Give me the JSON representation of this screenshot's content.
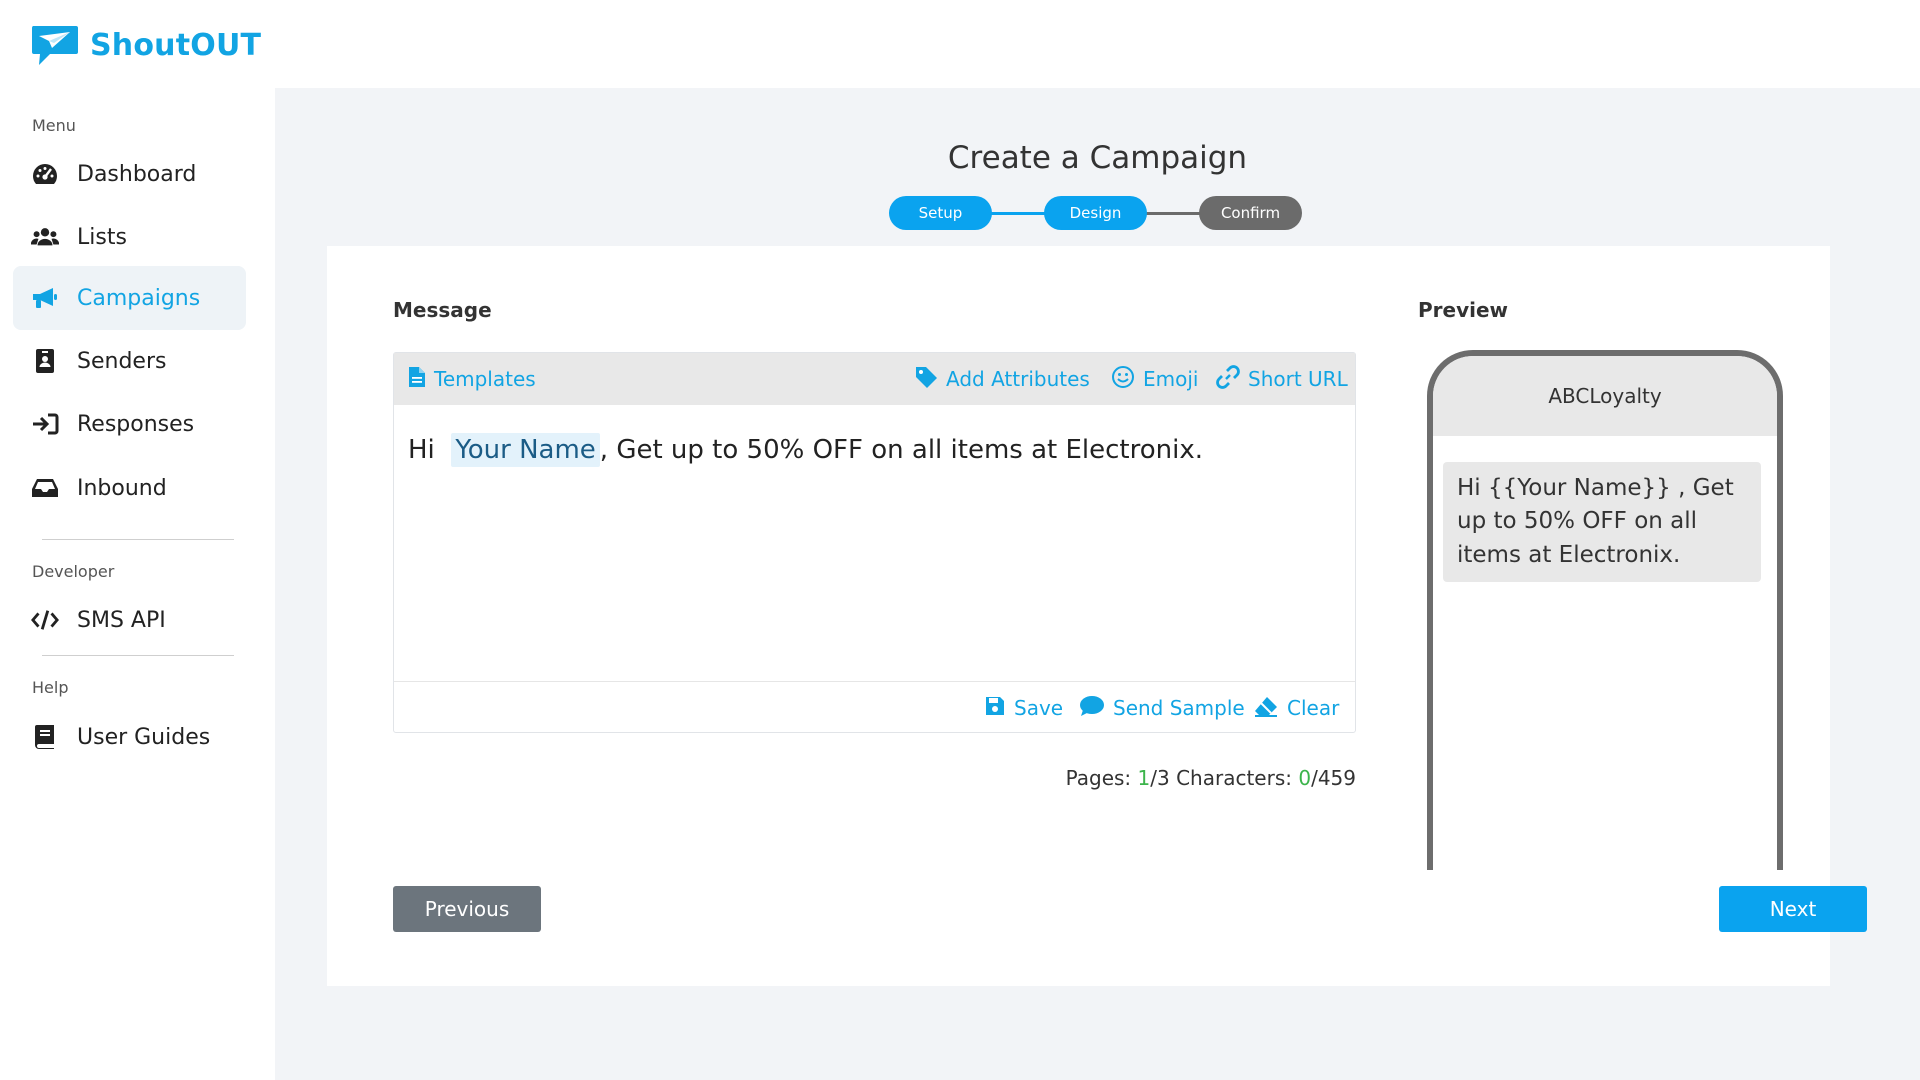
{
  "app": {
    "name": "ShoutOUT"
  },
  "colors": {
    "brand": "#12a4e3",
    "step_active": "#0aa3ef",
    "step_inactive": "#6b6b6b",
    "prev_button": "#6c757d",
    "count_green": "#3cb44b"
  },
  "sidebar": {
    "menu_label": "Menu",
    "items": [
      {
        "label": "Dashboard",
        "icon": "dashboard-icon"
      },
      {
        "label": "Lists",
        "icon": "users-icon"
      },
      {
        "label": "Campaigns",
        "icon": "megaphone-icon",
        "active": true
      },
      {
        "label": "Senders",
        "icon": "id-badge-icon"
      },
      {
        "label": "Responses",
        "icon": "sign-in-icon"
      },
      {
        "label": "Inbound",
        "icon": "inbox-icon"
      }
    ],
    "developer_label": "Developer",
    "developer_items": [
      {
        "label": "SMS API",
        "icon": "code-icon"
      }
    ],
    "help_label": "Help",
    "help_items": [
      {
        "label": "User Guides",
        "icon": "book-icon"
      }
    ]
  },
  "page": {
    "title": "Create a Campaign"
  },
  "stepper": {
    "steps": [
      {
        "label": "Setup",
        "active": true
      },
      {
        "label": "Design",
        "active": true
      },
      {
        "label": "Confirm",
        "active": false
      }
    ]
  },
  "editor": {
    "section_label": "Message",
    "toolbar": {
      "templates": "Templates",
      "add_attributes": "Add Attributes",
      "emoji": "Emoji",
      "short_url": "Short URL"
    },
    "message": {
      "prefix": "Hi",
      "attribute": "Your Name",
      "suffix": ", Get up to 50% OFF on all items at Electronix."
    },
    "footer": {
      "save": "Save",
      "send_sample": "Send Sample",
      "clear": "Clear"
    },
    "counter": {
      "pages_label": "Pages:",
      "pages_current": "1",
      "pages_total": "/3",
      "chars_label": "Characters:",
      "chars_current": "0",
      "chars_total": "/459"
    }
  },
  "preview": {
    "section_label": "Preview",
    "sender": "ABCLoyalty",
    "message": "Hi  {{Your Name}} , Get up to 50% OFF on all items at Electronix."
  },
  "actions": {
    "previous": "Previous",
    "next": "Next"
  }
}
